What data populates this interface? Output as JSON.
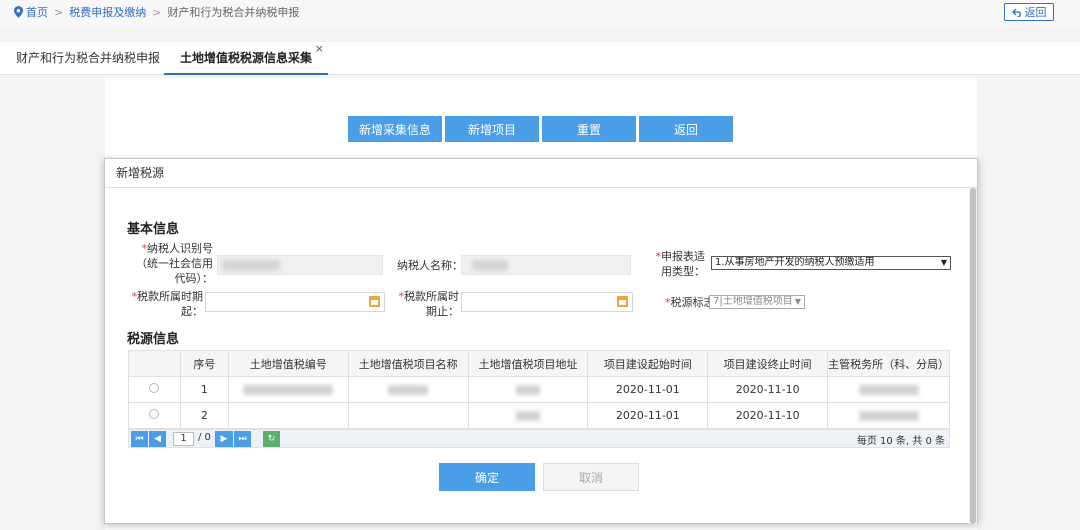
{
  "breadcrumb": {
    "home": "首页",
    "level1": "税费申报及缴纳",
    "current": "财产和行为税合并纳税申报"
  },
  "back_top": "返回",
  "tabs": [
    {
      "label": "财产和行为税合并纳税申报"
    },
    {
      "label": "土地增值税税源信息采集",
      "close": "×"
    }
  ],
  "toolbar": {
    "add_collect": "新增采集信息",
    "add_project": "新增项目",
    "reset": "重置",
    "back": "返回"
  },
  "modal": {
    "title": "新增税源",
    "basic_section": "基本信息",
    "taxpayer_id_label": "纳税人识别号（统一社会信用代码）：",
    "taxpayer_name_label": "纳税人名称：",
    "report_type_label": "申报表适用类型：",
    "report_type_value": "1.从事房地产开发的纳税人预缴适用",
    "period_start_label": "税款所属时期起：",
    "period_end_label": "税款所属时期止：",
    "tax_source_flag_label": "税源标志",
    "tax_source_flag_value": "7|土地增值税项目",
    "source_section": "税源信息",
    "table": {
      "headers": [
        "",
        "序号",
        "土地增值税编号",
        "土地增值税项目名称",
        "土地增值税项目地址",
        "项目建设起始时间",
        "项目建设终止时间",
        "主管税务所（科、分局）"
      ],
      "rows": [
        {
          "no": "1",
          "start": "2020-11-01",
          "end": "2020-11-10"
        },
        {
          "no": "2",
          "start": "2020-11-01",
          "end": "2020-11-10"
        }
      ]
    },
    "pager": {
      "page": "1",
      "total_pages": "/ 0",
      "info": "每页 10 条, 共 0 条"
    },
    "confirm": "确定",
    "cancel": "取消"
  },
  "colors": {
    "primary": "#4a9ee8",
    "link": "#2f6fc4",
    "required": "#ee3333"
  }
}
